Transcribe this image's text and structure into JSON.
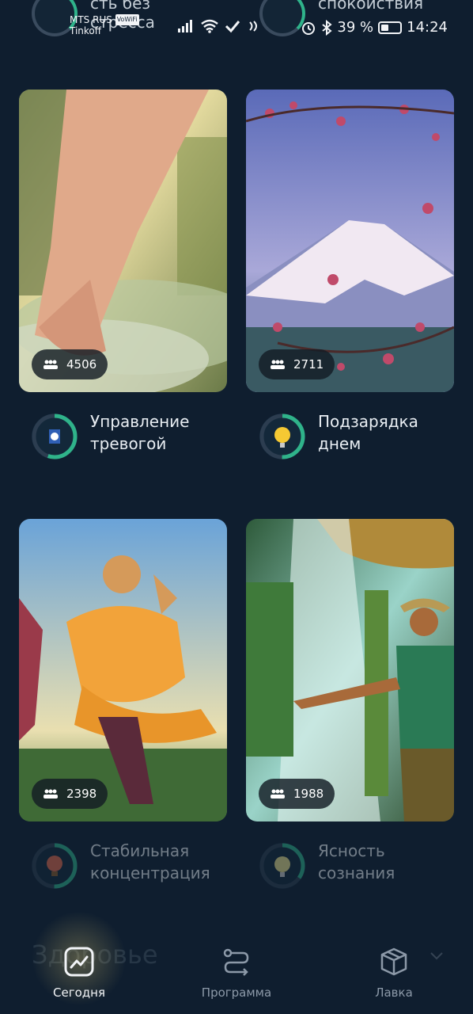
{
  "status_bar": {
    "carrier": "MTS RUS",
    "volte": "VoWiFi",
    "carrier2": "Tinkoff",
    "battery": "39 %",
    "time": "14:24"
  },
  "peek": [
    {
      "title": "сть без\nстресса"
    },
    {
      "title": "спокойствия"
    }
  ],
  "cards": [
    {
      "count": "4506",
      "title": "Управление тревогой",
      "ring_color": "#2fb38a",
      "progress": 0.55
    },
    {
      "count": "2711",
      "title": "Подзарядка днем",
      "ring_color": "#2fb38a",
      "progress": 0.5
    },
    {
      "count": "2398",
      "title": "Стабильная концентрация",
      "ring_color": "#2fb38a",
      "progress": 0.5
    },
    {
      "count": "1988",
      "title": "Ясность сознания",
      "ring_color": "#2fb38a",
      "progress": 0.35
    }
  ],
  "nav": {
    "ghost_text": "Здоровье",
    "items": [
      {
        "label": "Сегодня",
        "icon": "chart-icon",
        "active": true
      },
      {
        "label": "Программа",
        "icon": "route-icon",
        "active": false
      },
      {
        "label": "Лавка",
        "icon": "box-icon",
        "active": false
      }
    ]
  }
}
